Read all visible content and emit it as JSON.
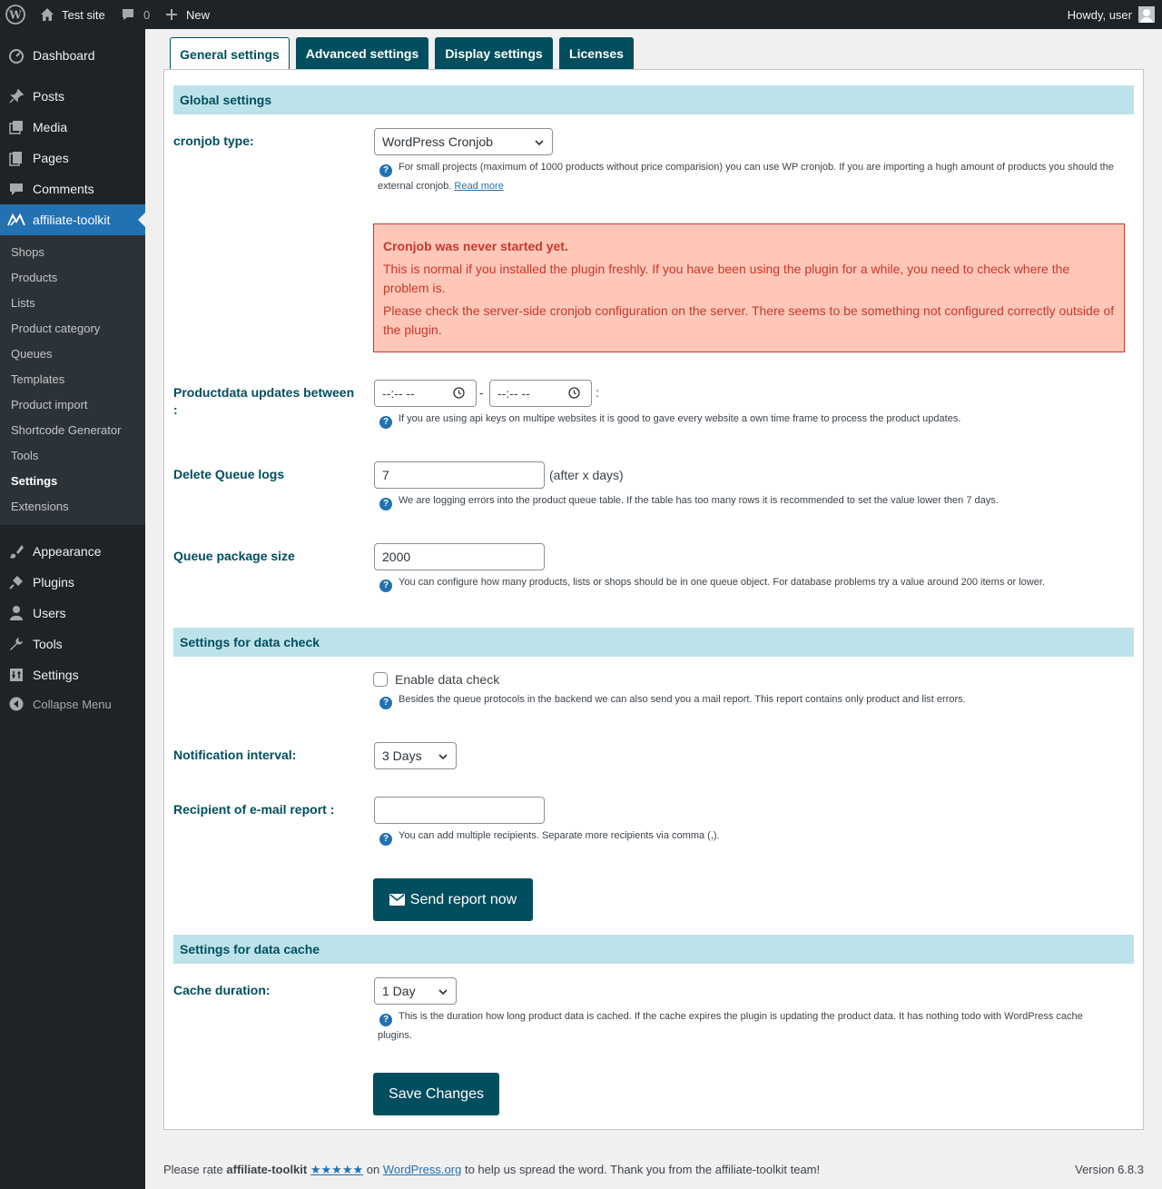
{
  "admin_bar": {
    "site_name": "Test site",
    "comments_count": "0",
    "new_label": "New",
    "greeting": "Howdy, user"
  },
  "sidebar": {
    "items": [
      {
        "label": "Dashboard",
        "icon": "dashboard-icon"
      },
      {
        "label": "Posts",
        "icon": "pin-icon"
      },
      {
        "label": "Media",
        "icon": "media-icon"
      },
      {
        "label": "Pages",
        "icon": "pages-icon"
      },
      {
        "label": "Comments",
        "icon": "comment-icon"
      },
      {
        "label": "affiliate-toolkit",
        "icon": "affiliate-toolkit-icon"
      }
    ],
    "submenu": [
      "Shops",
      "Products",
      "Lists",
      "Product category",
      "Queues",
      "Templates",
      "Product import",
      "Shortcode Generator",
      "Tools",
      "Settings",
      "Extensions"
    ],
    "lower_items": [
      {
        "label": "Appearance",
        "icon": "brush-icon"
      },
      {
        "label": "Plugins",
        "icon": "plug-icon"
      },
      {
        "label": "Users",
        "icon": "user-icon"
      },
      {
        "label": "Tools",
        "icon": "wrench-icon"
      },
      {
        "label": "Settings",
        "icon": "settings-icon"
      }
    ],
    "collapse_label": "Collapse Menu"
  },
  "tabs": [
    "General settings",
    "Advanced settings",
    "Display settings",
    "Licenses"
  ],
  "global_settings": {
    "heading": "Global settings",
    "cronjob_label": "cronjob type:",
    "cronjob_value": "WordPress Cronjob",
    "cronjob_help": "For small projects (maximum of 1000 products without price comparision) you can use WP cronjob. If you are importing a hugh amount of products you should the",
    "cronjob_help_2": "external cronjob.",
    "read_more": "Read more",
    "alert_title": "Cronjob was never started yet.",
    "alert_line1": "This is normal if you installed the plugin freshly. If you have been using the plugin for a while, you need to check where the problem is.",
    "alert_line2": "Please check the server-side cronjob configuration on the server. There seems to be something not configured correctly outside of the plugin.",
    "updates_label": "Productdata updates between :",
    "time_placeholder": "--:-- --",
    "time_separator": "-",
    "time_colon": ":",
    "updates_help": "If you are using api keys on multipe websites it is good to gave every website a own time frame to process the product updates.",
    "delete_logs_label": "Delete Queue logs",
    "delete_logs_value": "7",
    "delete_logs_suffix": "(after x days)",
    "delete_logs_help": "We are logging errors into the product queue table. If the table has too many rows it is recommended to set the value lower then 7 days.",
    "queue_size_label": "Queue package size",
    "queue_size_value": "2000",
    "queue_size_help": "You can configure how many products, lists or shops should be in one queue object. For database problems try a value around 200 items or lower."
  },
  "data_check": {
    "heading": "Settings for data check",
    "enable_label": "Enable data check",
    "enable_checked": false,
    "enable_help": "Besides the queue protocols in the backend we can also send you a mail report. This report contains only product and list errors.",
    "interval_label": "Notification interval:",
    "interval_value": "3 Days",
    "recipient_label": "Recipient of e-mail report :",
    "recipient_value": "",
    "recipient_help": "You can add multiple recipients. Separate more recipients via comma (,).",
    "send_button": "Send report now"
  },
  "data_cache": {
    "heading": "Settings for data cache",
    "duration_label": "Cache duration:",
    "duration_value": "1 Day",
    "duration_help": "This is the duration how long product data is cached. If the cache expires the plugin is updating the product data. It has nothing todo with WordPress cache",
    "duration_help_2": "plugins."
  },
  "save_button": "Save Changes",
  "footer": {
    "prefix": "Please rate",
    "plugin": "affiliate-toolkit",
    "stars": "★★★★★",
    "on": "on",
    "link": "WordPress.org",
    "suffix": "to help us spread the word. Thank you from the affiliate-toolkit team!",
    "version": "Version 6.8.3"
  },
  "colors": {
    "accent": "#004e5e",
    "section_bg": "#bde3ea",
    "alert_bg": "#ffc7b8",
    "alert_text": "#c9382a",
    "admin_blue": "#2271b1"
  }
}
